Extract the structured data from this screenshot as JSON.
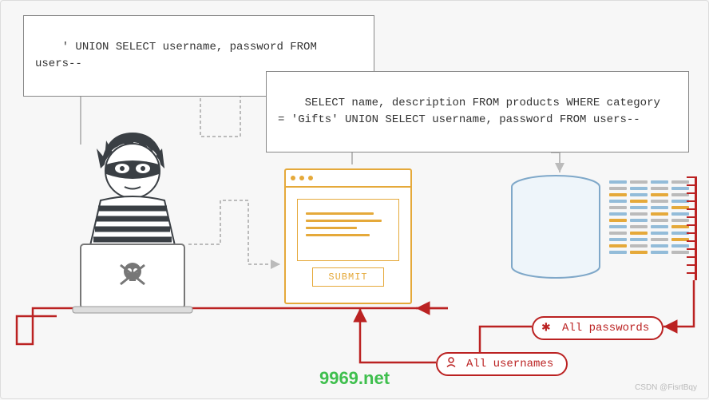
{
  "injection_query": "' UNION SELECT username, password FROM users--",
  "resulting_query": "SELECT name, description FROM products WHERE category\n= 'Gifts' UNION SELECT username, password FROM users--",
  "form": {
    "submit_label": "SUBMIT"
  },
  "outputs": {
    "passwords_label": "All passwords",
    "usernames_label": "All usernames"
  },
  "watermark": "9969.net",
  "credit": "CSDN @FisrtBqy",
  "chart_data": {
    "type": "diagram",
    "topic": "SQL Injection (UNION-based) attack flow",
    "actors": [
      "attacker",
      "web-form",
      "database"
    ],
    "steps": [
      "Attacker crafts on laptop: ' UNION SELECT username, password FROM users--",
      "Payload submitted via web form SUBMIT",
      "Server builds query: SELECT name, description FROM products WHERE category = 'Gifts' UNION SELECT username, password FROM users--",
      "Database executes combined query",
      "Response leaks All usernames and All passwords back to attacker"
    ],
    "arrows_grey_forward": [
      "attacker→injection_query",
      "attacker→form",
      "form→resulting_query",
      "resulting_query→database"
    ],
    "arrows_red_return": [
      "database→passwords",
      "database→usernames",
      "usernames→form",
      "form→attacker"
    ]
  }
}
